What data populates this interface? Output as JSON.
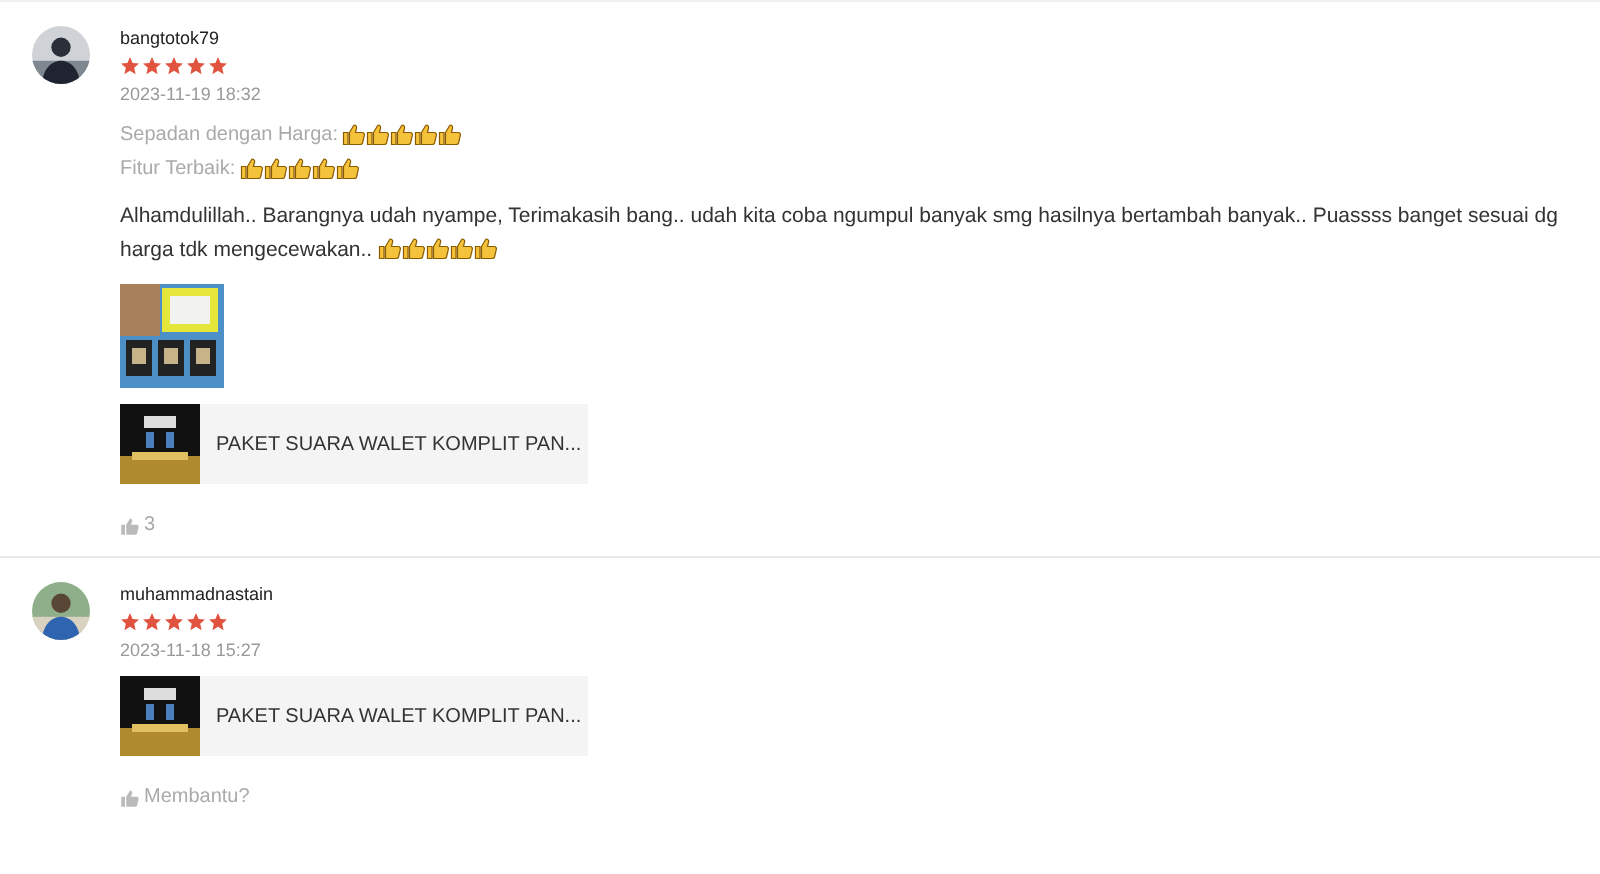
{
  "reviews": [
    {
      "username": "bangtotok79",
      "stars": 5,
      "date": "2023-11-19 18:32",
      "attributes": [
        {
          "label": "Sepadan dengan Harga:",
          "emoji": [
            {
              "kind": "thumbs-up"
            },
            {
              "kind": "thumbs-up"
            },
            {
              "kind": "thumbs-up"
            },
            {
              "kind": "thumbs-up"
            },
            {
              "kind": "thumbs-up"
            }
          ]
        },
        {
          "label": "Fitur Terbaik:",
          "emoji": [
            {
              "kind": "thumbs-up"
            },
            {
              "kind": "thumbs-up"
            },
            {
              "kind": "thumbs-up"
            },
            {
              "kind": "thumbs-up"
            },
            {
              "kind": "thumbs-up"
            }
          ]
        }
      ],
      "comment": "Alhamdulillah.. Barangnya udah nyampe,  Terimakasih bang.. udah kita coba ngumpul banyak smg hasilnya bertambah banyak.. Puassss banget sesuai dg harga tdk mengecewakan..",
      "comment_emoji": [
        {
          "kind": "thumbs-up"
        },
        {
          "kind": "thumbs-up"
        },
        {
          "kind": "thumbs-up"
        },
        {
          "kind": "thumbs-up"
        },
        {
          "kind": "thumbs-up"
        }
      ],
      "photos": [
        {
          "kind": "picture"
        }
      ],
      "product": {
        "name": "PAKET SUARA WALET KOMPLIT PAN..."
      },
      "likes": "3"
    },
    {
      "username": "muhammadnastain",
      "stars": 5,
      "date": "2023-11-18 15:27",
      "product": {
        "name": "PAKET SUARA WALET KOMPLIT PAN..."
      },
      "likes": "Membantu?"
    }
  ]
}
